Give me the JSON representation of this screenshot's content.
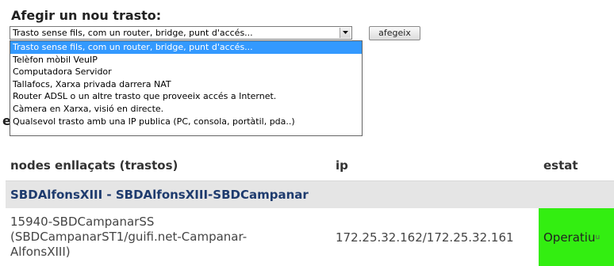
{
  "form": {
    "title": "Afegir un nou trasto:",
    "selected_value": "Trasto sense fils, com un router, bridge, punt d'accés...",
    "add_button_label": "afegeix",
    "options": [
      "Trasto sense fils, com un router, bridge, punt d'accés...",
      "Telèfon mòbil VeuIP",
      "Computadora Servidor",
      "Tallafocs, Xarxa privada darrera NAT",
      "Router ADSL o un altre trasto que proveeix accés a Internet.",
      "Càmera en Xarxa, visió en directe.",
      "Qualsevol trasto amb una IP publica (PC, consola, portàtil, pda..)"
    ],
    "selected_index": 0,
    "partially_hidden_heading": "e"
  },
  "table": {
    "headers": {
      "nodes": "nodes enllaçats (trastos)",
      "ip": "ip",
      "state": "estat"
    },
    "group_label": "SBDAlfonsXIII - SBDAlfonsXIII-SBDCampanar",
    "row": {
      "device_line1": "15940-SBDCampanarSS",
      "device_line2": "(SBDCampanarST1/guifi.net-Campanar-",
      "device_line3": "AlfonsXIII)",
      "ip": "172.25.32.162/172.25.32.161",
      "state": "Operatiu",
      "state_suffix": "u"
    }
  },
  "colors": {
    "selected_option_bg": "#3399ff",
    "group_row_bg": "#e5e5e5",
    "group_row_text": "#1e3b6e",
    "status_ok_bg": "#33ee11"
  },
  "icons": {
    "select_arrow": "chevron-down-icon"
  }
}
